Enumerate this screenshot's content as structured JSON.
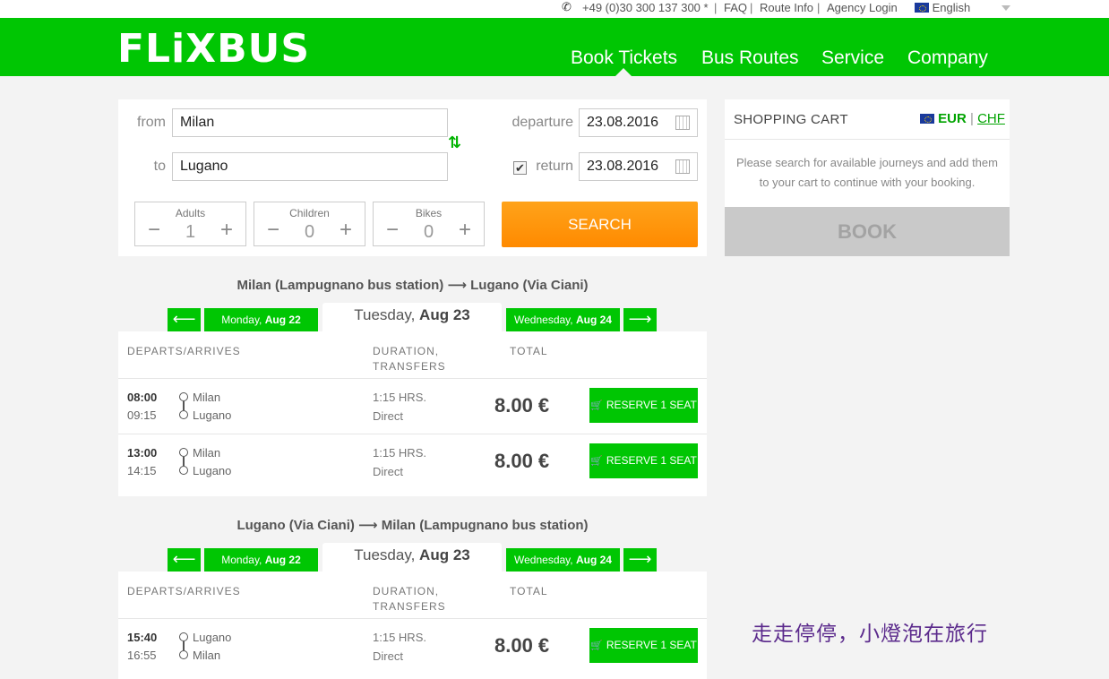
{
  "topbar": {
    "phone": "+49 (0)30 300 137 300 *",
    "links": [
      "FAQ",
      "Route Info",
      "Agency Login"
    ],
    "language": "English"
  },
  "header": {
    "logo": "FLiXBUS",
    "nav": [
      "Book Tickets",
      "Bus Routes",
      "Service",
      "Company"
    ],
    "active_nav": "Book Tickets"
  },
  "search": {
    "from_label": "from",
    "from_value": "Milan",
    "to_label": "to",
    "to_value": "Lugano",
    "departure_label": "departure",
    "departure_value": "23.08.2016",
    "return_label": "return",
    "return_value": "23.08.2016",
    "return_checked": true,
    "counters": [
      {
        "label": "Adults",
        "value": "1"
      },
      {
        "label": "Children",
        "value": "0"
      },
      {
        "label": "Bikes",
        "value": "0"
      }
    ],
    "search_label": "SEARCH"
  },
  "cart": {
    "title": "SHOPPING CART",
    "currency_active": "EUR",
    "currency_other": "CHF",
    "message": "Please search for available journeys and add them to your cart to continue with your booking.",
    "book_label": "BOOK"
  },
  "routes": [
    {
      "title": "Milan (Lampugnano bus station) ⟶ Lugano (Via Ciani)",
      "prev_day": {
        "weekday": "Monday,",
        "date": "Aug 22"
      },
      "current_day": {
        "weekday": "Tuesday,",
        "date": "Aug 23"
      },
      "next_day": {
        "weekday": "Wednesday,",
        "date": "Aug 24"
      },
      "headers": {
        "departs": "DEPARTS/ARRIVES",
        "duration_1": "DURATION,",
        "duration_2": "TRANSFERS",
        "total": "TOTAL"
      },
      "rides": [
        {
          "dep": "08:00",
          "arr": "09:15",
          "from": "Milan",
          "to": "Lugano",
          "duration": "1:15 HRS.",
          "transfers": "Direct",
          "price": "8.00 €",
          "action": "RESERVE 1 SEAT"
        },
        {
          "dep": "13:00",
          "arr": "14:15",
          "from": "Milan",
          "to": "Lugano",
          "duration": "1:15 HRS.",
          "transfers": "Direct",
          "price": "8.00 €",
          "action": "RESERVE 1 SEAT"
        }
      ]
    },
    {
      "title": "Lugano (Via Ciani) ⟶ Milan (Lampugnano bus station)",
      "prev_day": {
        "weekday": "Monday,",
        "date": "Aug 22"
      },
      "current_day": {
        "weekday": "Tuesday,",
        "date": "Aug 23"
      },
      "next_day": {
        "weekday": "Wednesday,",
        "date": "Aug 24"
      },
      "headers": {
        "departs": "DEPARTS/ARRIVES",
        "duration_1": "DURATION,",
        "duration_2": "TRANSFERS",
        "total": "TOTAL"
      },
      "rides": [
        {
          "dep": "15:40",
          "arr": "16:55",
          "from": "Lugano",
          "to": "Milan",
          "duration": "1:15 HRS.",
          "transfers": "Direct",
          "price": "8.00 €",
          "action": "RESERVE 1 SEAT"
        }
      ]
    }
  ],
  "watermark": "走走停停，小燈泡在旅行",
  "colors": {
    "brand_green": "#00c603",
    "search_orange": "#ff8a00",
    "book_disabled": "#c9c9c9"
  }
}
